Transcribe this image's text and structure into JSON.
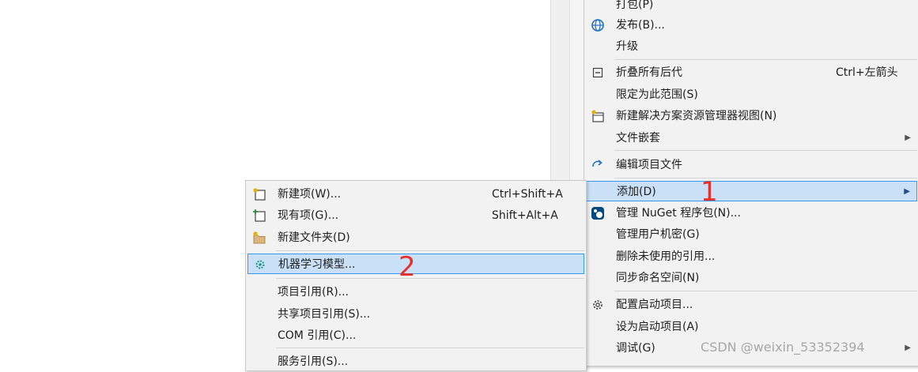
{
  "context_menu": {
    "items": [
      {
        "label": "打包(P)",
        "icon": "package-icon"
      },
      {
        "label": "发布(B)...",
        "icon": "globe-icon"
      },
      {
        "label": "升级",
        "icon": ""
      },
      {
        "label": "折叠所有后代",
        "icon": "collapse-icon",
        "shortcut": "Ctrl+左箭头"
      },
      {
        "label": "限定为此范围(S)",
        "icon": ""
      },
      {
        "label": "新建解决方案资源管理器视图(N)",
        "icon": "new-view-icon"
      },
      {
        "label": "文件嵌套",
        "icon": "",
        "submenu": true
      },
      {
        "label": "编辑项目文件",
        "icon": "edit-project-icon"
      },
      {
        "label": "添加(D)",
        "icon": "",
        "submenu": true,
        "highlighted": true
      },
      {
        "label": "管理 NuGet 程序包(N)...",
        "icon": "nuget-icon"
      },
      {
        "label": "管理用户机密(G)",
        "icon": ""
      },
      {
        "label": "删除未使用的引用...",
        "icon": ""
      },
      {
        "label": "同步命名空间(N)",
        "icon": ""
      },
      {
        "label": "配置启动项目...",
        "icon": "gear-icon"
      },
      {
        "label": "设为启动项目(A)",
        "icon": ""
      },
      {
        "label": "调试(G)",
        "icon": "",
        "submenu": true
      }
    ]
  },
  "add_submenu": {
    "items": [
      {
        "label": "新建项(W)...",
        "icon": "new-item-icon",
        "shortcut": "Ctrl+Shift+A"
      },
      {
        "label": "现有项(G)...",
        "icon": "existing-item-icon",
        "shortcut": "Shift+Alt+A"
      },
      {
        "label": "新建文件夹(D)",
        "icon": "new-folder-icon"
      },
      {
        "label": "机器学习模型...",
        "icon": "ml-model-icon",
        "highlighted": true
      },
      {
        "label": "项目引用(R)...",
        "icon": ""
      },
      {
        "label": "共享项目引用(S)...",
        "icon": ""
      },
      {
        "label": "COM 引用(C)...",
        "icon": ""
      },
      {
        "label": "服务引用(S)...",
        "icon": ""
      }
    ]
  },
  "annotations": {
    "one": "1",
    "two": "2"
  },
  "watermark": "CSDN @weixin_53352394",
  "colors": {
    "highlight_bg": "#c9e0f7",
    "highlight_border": "#3399ff",
    "annotation": "#e8302a"
  }
}
